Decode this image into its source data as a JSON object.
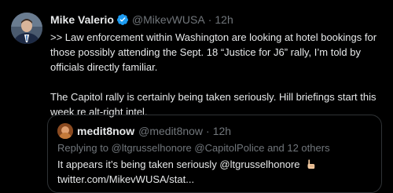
{
  "tweet": {
    "author_name": "Mike Valerio",
    "author_handle": "@MikevWUSA",
    "separator": "·",
    "time": "12h",
    "line1": ">> Law enforcement within Washington are looking at hotel bookings for those possibly attending the Sept. 18 “Justice for J6” rally, I’m told by officials directly familiar.",
    "line2": "The Capitol rally is certainly being taken seriously. Hill briefings start this week re alt-right intel."
  },
  "quote": {
    "author_name": "medit8now",
    "author_handle": "@medit8now",
    "separator": "·",
    "time": "12h",
    "replying_prefix": "Replying to",
    "replying_mentions": "@ltgrusselhonore @CapitolPolice",
    "replying_suffix": "and 12 others",
    "text": "It appears it’s being taken seriously @ltgrusselhonore",
    "link": "twitter.com/MikevWUSA/stat..."
  },
  "colors": {
    "background": "#000000",
    "text": "#e7e9ea",
    "muted": "#71767b",
    "border": "#2f3336",
    "verified": "#1d9bf0"
  },
  "icons": {
    "verified": "verified-badge-icon",
    "hand": "pointing-hand-emoji-icon"
  }
}
